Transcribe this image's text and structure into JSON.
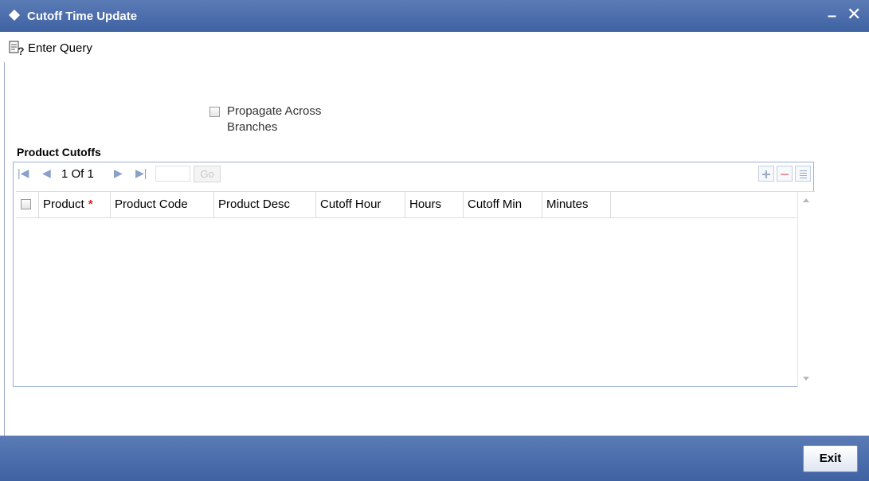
{
  "window": {
    "title": "Cutoff Time Update",
    "minimize_glyph": "–",
    "close_glyph": "✕"
  },
  "toolbar": {
    "enter_query_label": "Enter Query"
  },
  "form": {
    "propagate_label": "Propagate Across Branches",
    "propagate_checked": false
  },
  "product_cutoffs": {
    "section_title": "Product Cutoffs",
    "pager": {
      "page_info": "1 Of 1",
      "go_label": "Go",
      "page_input_value": ""
    },
    "columns": [
      {
        "label": "Product",
        "required": true
      },
      {
        "label": "Product Code"
      },
      {
        "label": "Product Desc"
      },
      {
        "label": "Cutoff Hour"
      },
      {
        "label": "Hours"
      },
      {
        "label": "Cutoff Min"
      },
      {
        "label": "Minutes"
      }
    ],
    "required_marker": "*",
    "rows": []
  },
  "footer": {
    "exit_label": "Exit"
  },
  "colors": {
    "titlebar": "#4a6cab",
    "panel_border": "#9ab0d4",
    "required": "#dd2222"
  },
  "icons": [
    "diamond-icon",
    "minimize-icon",
    "close-icon",
    "enter-query-icon",
    "first-page-icon",
    "prev-page-icon",
    "next-page-icon",
    "last-page-icon",
    "add-row-icon",
    "delete-row-icon",
    "single-record-view-icon",
    "scroll-up-icon",
    "scroll-down-icon"
  ]
}
